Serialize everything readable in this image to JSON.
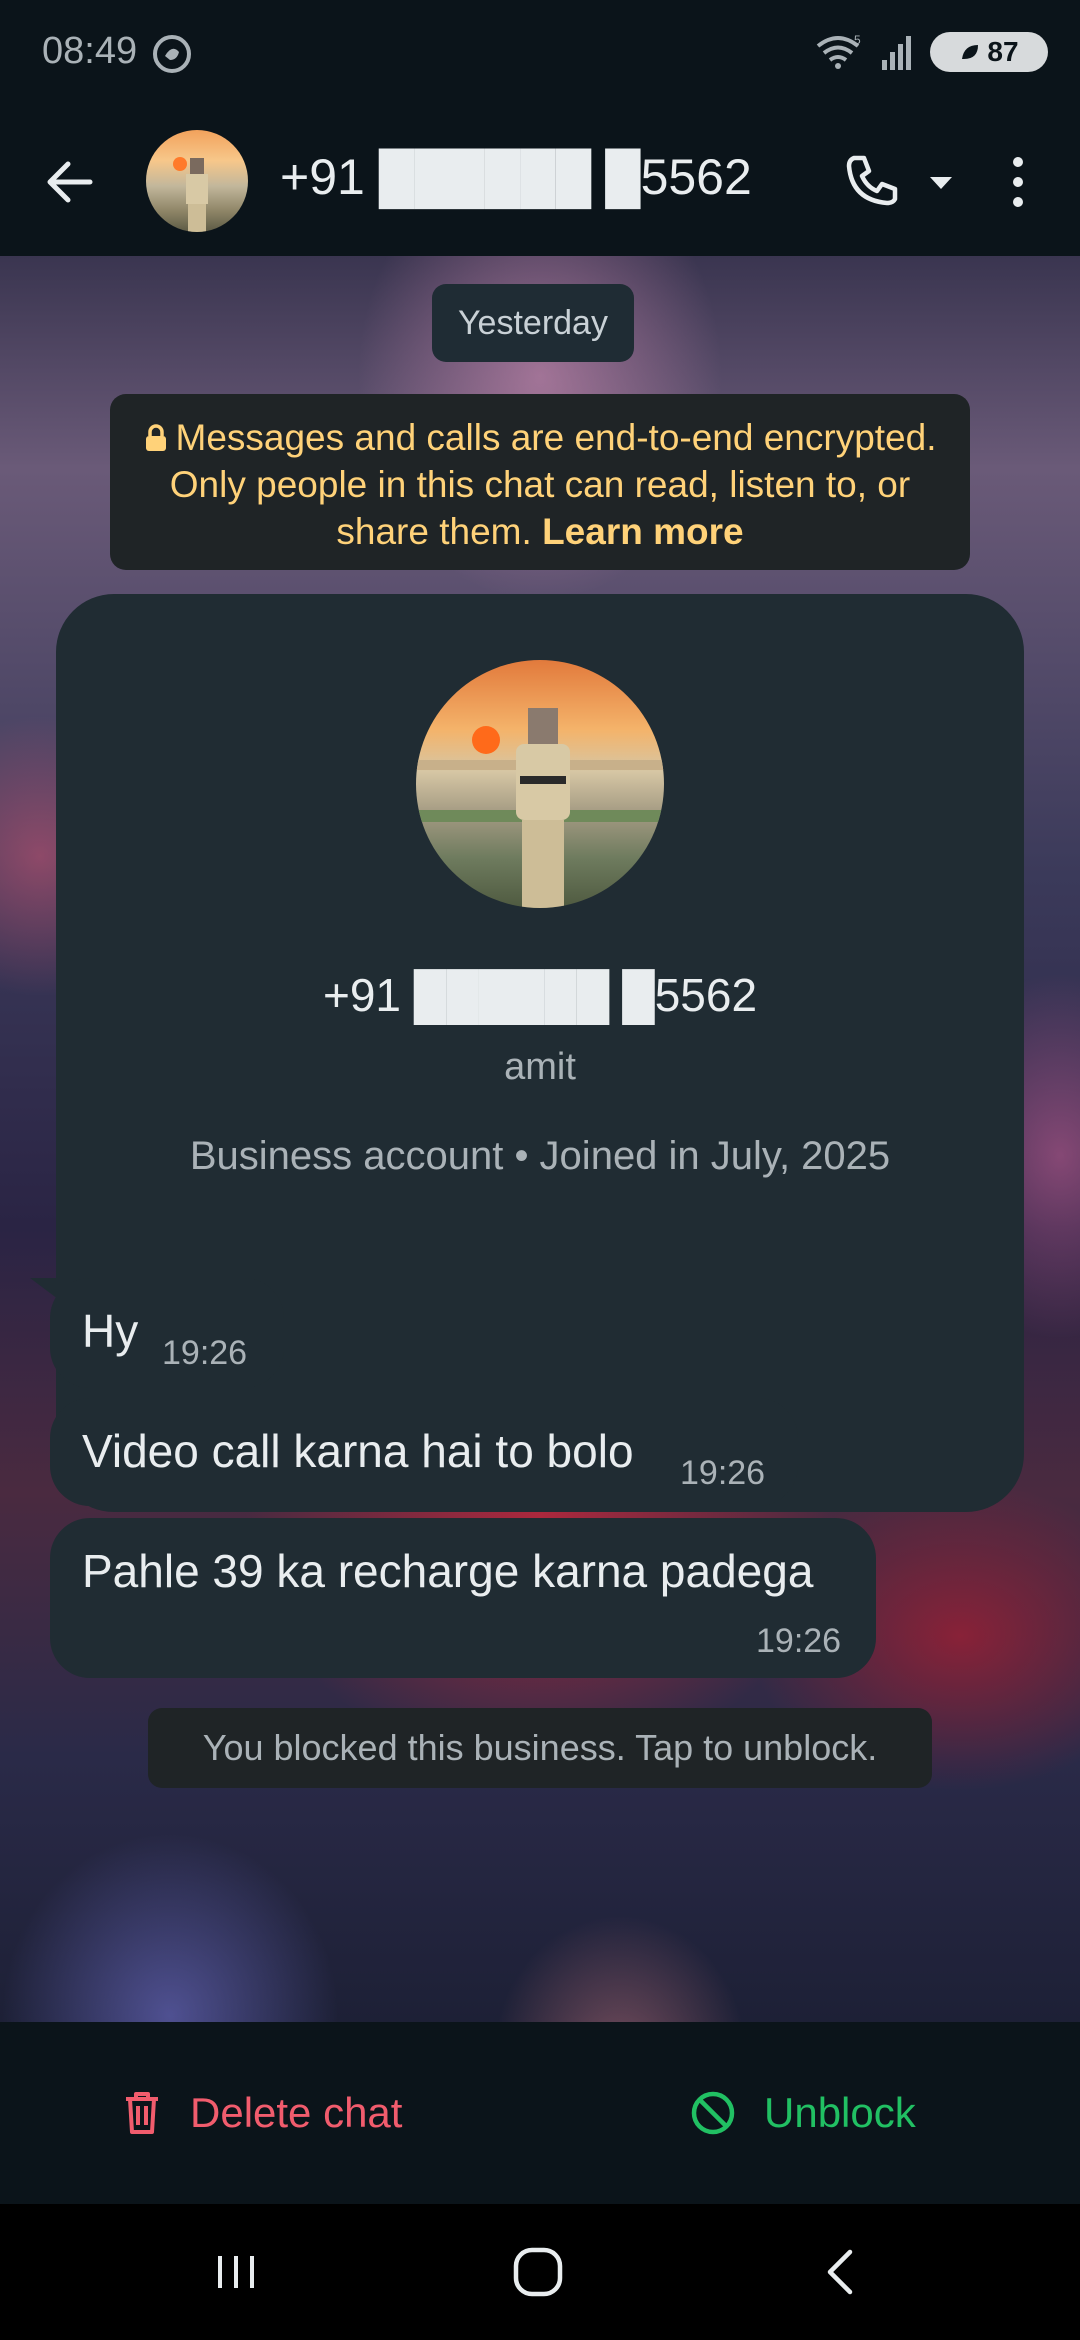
{
  "status_bar": {
    "time": "08:49",
    "battery": "87"
  },
  "header": {
    "title": "+91 ██████ █5562"
  },
  "chat": {
    "date_chip": "Yesterday",
    "e2e_notice": "Messages and calls are end-to-end encrypted. Only people in this chat can read, listen to, or share them.",
    "e2e_link": "Learn more",
    "profile": {
      "phone": "+91 ██████ █5562",
      "name": "amit",
      "meta": "Business account • Joined in July, 2025"
    },
    "messages": [
      {
        "text": "Hy",
        "time": "19:26"
      },
      {
        "text": "Video call karna hai to bolo",
        "time": "19:26"
      },
      {
        "text": "Pahle 39 ka recharge karna padega",
        "time": "19:26"
      }
    ],
    "blocked_notice": "You blocked this business. Tap to unblock."
  },
  "actions": {
    "delete_label": "Delete chat",
    "unblock_label": "Unblock"
  },
  "colors": {
    "background": "#0b141a",
    "bubble": "#202c33",
    "notice_text": "#ffd279",
    "delete": "#f15c6d",
    "unblock": "#21c063"
  },
  "icons": [
    "back-arrow-icon",
    "phone-icon",
    "dropdown-icon",
    "more-vert-icon",
    "lock-icon",
    "trash-icon",
    "block-icon",
    "recents-icon",
    "home-icon",
    "nav-back-icon"
  ]
}
